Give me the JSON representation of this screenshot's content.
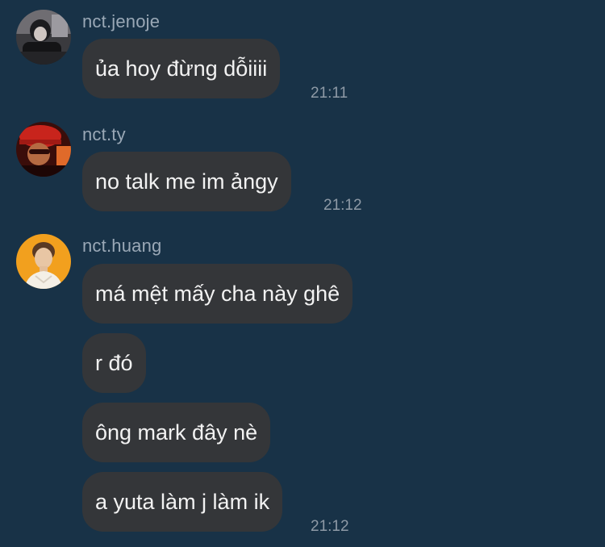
{
  "conversation": [
    {
      "sender": "nct.jenoje",
      "avatar_icon": "profile-photo-dark-jacket",
      "messages": [
        {
          "text": "ủa hoy đừng dỗiiii",
          "time": "21:11"
        }
      ]
    },
    {
      "sender": "nct.ty",
      "avatar_icon": "profile-photo-red-cap",
      "messages": [
        {
          "text": "no talk me im ảngy",
          "time": "21:12"
        }
      ]
    },
    {
      "sender": "nct.huang",
      "avatar_icon": "profile-photo-orange-background",
      "messages": [
        {
          "text": "má mệt mấy cha này ghê",
          "time": ""
        },
        {
          "text": "r đó",
          "time": ""
        },
        {
          "text": "ông mark đây nè",
          "time": ""
        },
        {
          "text": "a yuta làm j làm ik",
          "time": "21:12"
        }
      ]
    }
  ],
  "colors": {
    "background": "#183247",
    "bubble": "#343639",
    "bubble_text": "#f2f2f2",
    "sender_name": "#9aa8b6",
    "timestamp": "#8e9aa6"
  }
}
